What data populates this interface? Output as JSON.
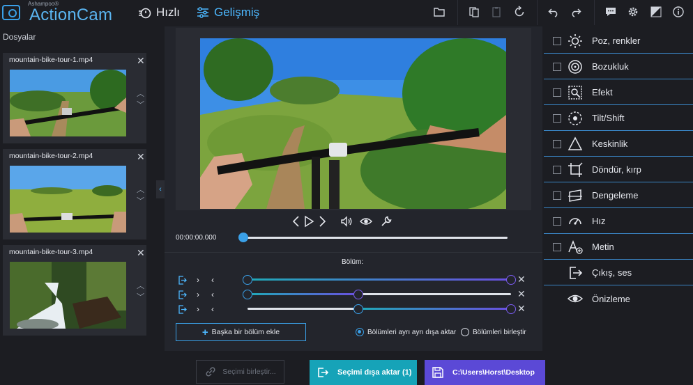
{
  "brand": {
    "company": "Ashampoo®",
    "name": "ActionCam"
  },
  "modes": {
    "fast": "Hızlı",
    "advanced": "Gelişmiş"
  },
  "colors": {
    "accent": "#4db8ff",
    "export_button": "#16a3b8",
    "path_button": "#5b49d6",
    "background": "#1c1d22"
  },
  "toolbar_icons": [
    "folder-icon",
    "copy-icon",
    "clipboard-icon",
    "reset-icon",
    "undo-icon",
    "redo-icon",
    "feedback-icon",
    "settings-icon",
    "theme-icon",
    "info-icon"
  ],
  "files": {
    "title": "Dosyalar",
    "items": [
      {
        "name": "mountain-bike-tour-1.mp4"
      },
      {
        "name": "mountain-bike-tour-2.mp4"
      },
      {
        "name": "mountain-bike-tour-3.mp4"
      }
    ]
  },
  "player": {
    "timecode": "00:00:00.000",
    "position_fraction": 0,
    "controls": [
      "previous-frame-icon",
      "play-icon",
      "next-frame-icon",
      "volume-icon",
      "preview-eye-icon",
      "wrench-icon"
    ]
  },
  "sections": {
    "label": "Bölüm:",
    "rows": [
      {
        "start": 0.0,
        "end": 1.0
      },
      {
        "start": 0.0,
        "end": 0.42
      },
      {
        "start": 0.42,
        "end": 1.0
      }
    ],
    "add_button": "Başka bir bölüm ekle",
    "export_separately": "Bölümleri ayrı ayrı dışa aktar",
    "merge_sections": "Bölümleri birleştir",
    "selected_option": "export_separately"
  },
  "effects": [
    {
      "label": "Poz, renkler",
      "icon": "exposure-icon",
      "checkbox": true
    },
    {
      "label": "Bozukluk",
      "icon": "distortion-icon",
      "checkbox": true
    },
    {
      "label": "Efekt",
      "icon": "effect-icon",
      "checkbox": true
    },
    {
      "label": "Tilt/Shift",
      "icon": "tilt-shift-icon",
      "checkbox": true
    },
    {
      "label": "Keskinlik",
      "icon": "sharpness-icon",
      "checkbox": true
    },
    {
      "label": "Döndür, kırp",
      "icon": "crop-icon",
      "checkbox": true
    },
    {
      "label": "Dengeleme",
      "icon": "stabilize-icon",
      "checkbox": true
    },
    {
      "label": "Hız",
      "icon": "speed-icon",
      "checkbox": true
    },
    {
      "label": "Metin",
      "icon": "text-icon",
      "checkbox": true
    },
    {
      "label": "Çıkış, ses",
      "icon": "output-icon",
      "checkbox": false
    },
    {
      "label": "Önizleme",
      "icon": "preview-icon",
      "checkbox": false
    }
  ],
  "bottom": {
    "merge_selection": "Seçimi birleştir...",
    "export_selection": "Seçimi dışa aktar (1)",
    "output_path": "C:\\Users\\Horst\\Desktop"
  }
}
